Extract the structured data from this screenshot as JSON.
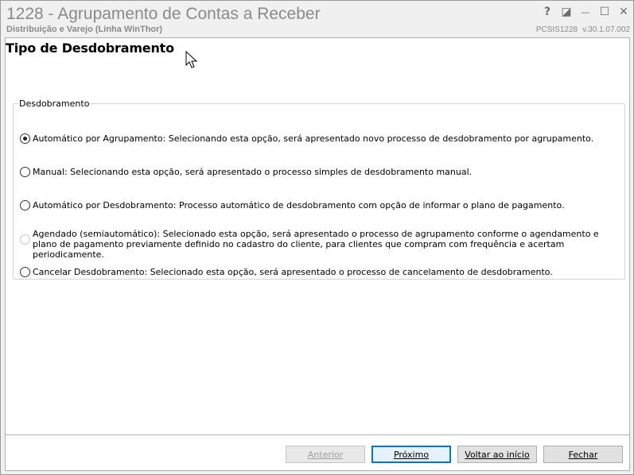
{
  "window": {
    "title": "1228 - Agrupamento de Contas a Receber",
    "subtitle": "Distribuição e Varejo (Linha WinThor)",
    "program_code": "PCSIS1228",
    "version": "v.30.1.07.002",
    "controls": {
      "help": "?",
      "restore": "◪",
      "minimize": "—",
      "maximize": "☐",
      "close": "✕"
    }
  },
  "page": {
    "title": "Tipo de Desdobramento"
  },
  "group": {
    "legend": "Desdobramento",
    "options": [
      {
        "label": "Automático por Agrupamento: Selecionando esta opção, será apresentado novo processo de desdobramento por agrupamento.",
        "checked": true,
        "enabled": true
      },
      {
        "label": "Manual: Selecionando esta opção, será apresentado o processo simples de desdobramento manual.",
        "checked": false,
        "enabled": true
      },
      {
        "label": "Automático por Desdobramento: Processo automático de desdobramento com opção de informar o plano de pagamento.",
        "checked": false,
        "enabled": true
      },
      {
        "label": "Agendado (semiautomático): Selecionado esta opção, será apresentado o processo de agrupamento conforme o agendamento e plano de pagamento previamente definido no cadastro do cliente, para clientes que compram com frequência e acertam periodicamente.",
        "checked": false,
        "enabled": false
      },
      {
        "label": "Cancelar Desdobramento: Selecionado esta opção, será apresentado o processo de cancelamento de desdobramento.",
        "checked": false,
        "enabled": true
      }
    ]
  },
  "buttons": {
    "previous": "Anterior",
    "next": "Próximo",
    "back_to_start": "Voltar ao início",
    "close": "Fechar"
  }
}
